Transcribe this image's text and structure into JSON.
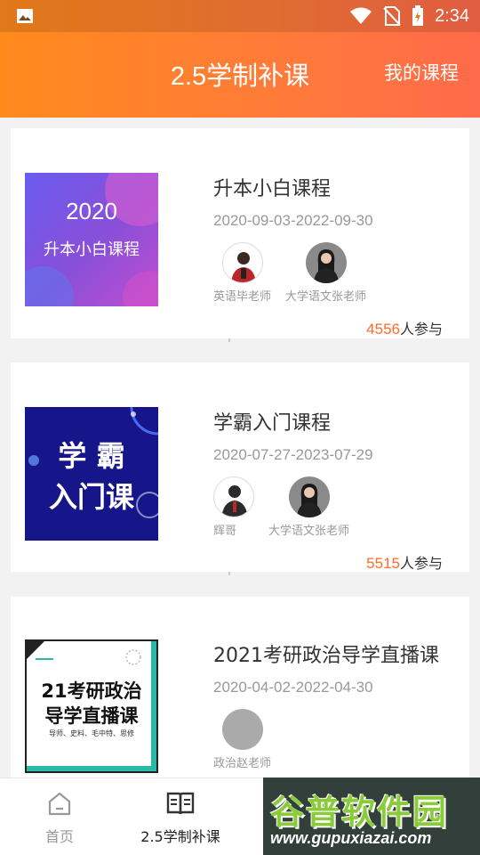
{
  "status_bar": {
    "time": "2:34"
  },
  "header": {
    "title": "2.5学制补课",
    "action": "我的课程"
  },
  "courses": [
    {
      "cover_line1": "2020",
      "cover_line2": "升本小白课程",
      "title": "升本小白课程",
      "date": "2020-09-03-2022-09-30",
      "teachers": [
        {
          "name": "英语毕老师"
        },
        {
          "name": "大学语文张老师"
        }
      ],
      "participants_count": "4556",
      "participants_suffix": "人参与"
    },
    {
      "cover_line1": "学 霸",
      "cover_line2": "入门课",
      "title": "学霸入门课程",
      "date": "2020-07-27-2023-07-29",
      "teachers": [
        {
          "name": "辉哥"
        },
        {
          "name": "大学语文张老师"
        }
      ],
      "participants_count": "5515",
      "participants_suffix": "人参与"
    },
    {
      "cover_line1": "21考研政治",
      "cover_line2": "导学直播课",
      "cover_line3": "导师、史料、毛中特、思修",
      "title": "2021考研政治导学直播课",
      "date": "2020-04-02-2022-04-30",
      "teachers": [
        {
          "name": "政治赵老师"
        }
      ]
    }
  ],
  "bottom_nav": {
    "items": [
      {
        "label": "首页"
      },
      {
        "label": "2.5学制补课"
      }
    ]
  },
  "watermark": {
    "big": "谷普软件园",
    "small": "www.gupuxiazai.com"
  },
  "colors": {
    "accent": "#ff6a2a",
    "header_start": "#ff8a1c",
    "header_end": "#ff6a4a"
  }
}
